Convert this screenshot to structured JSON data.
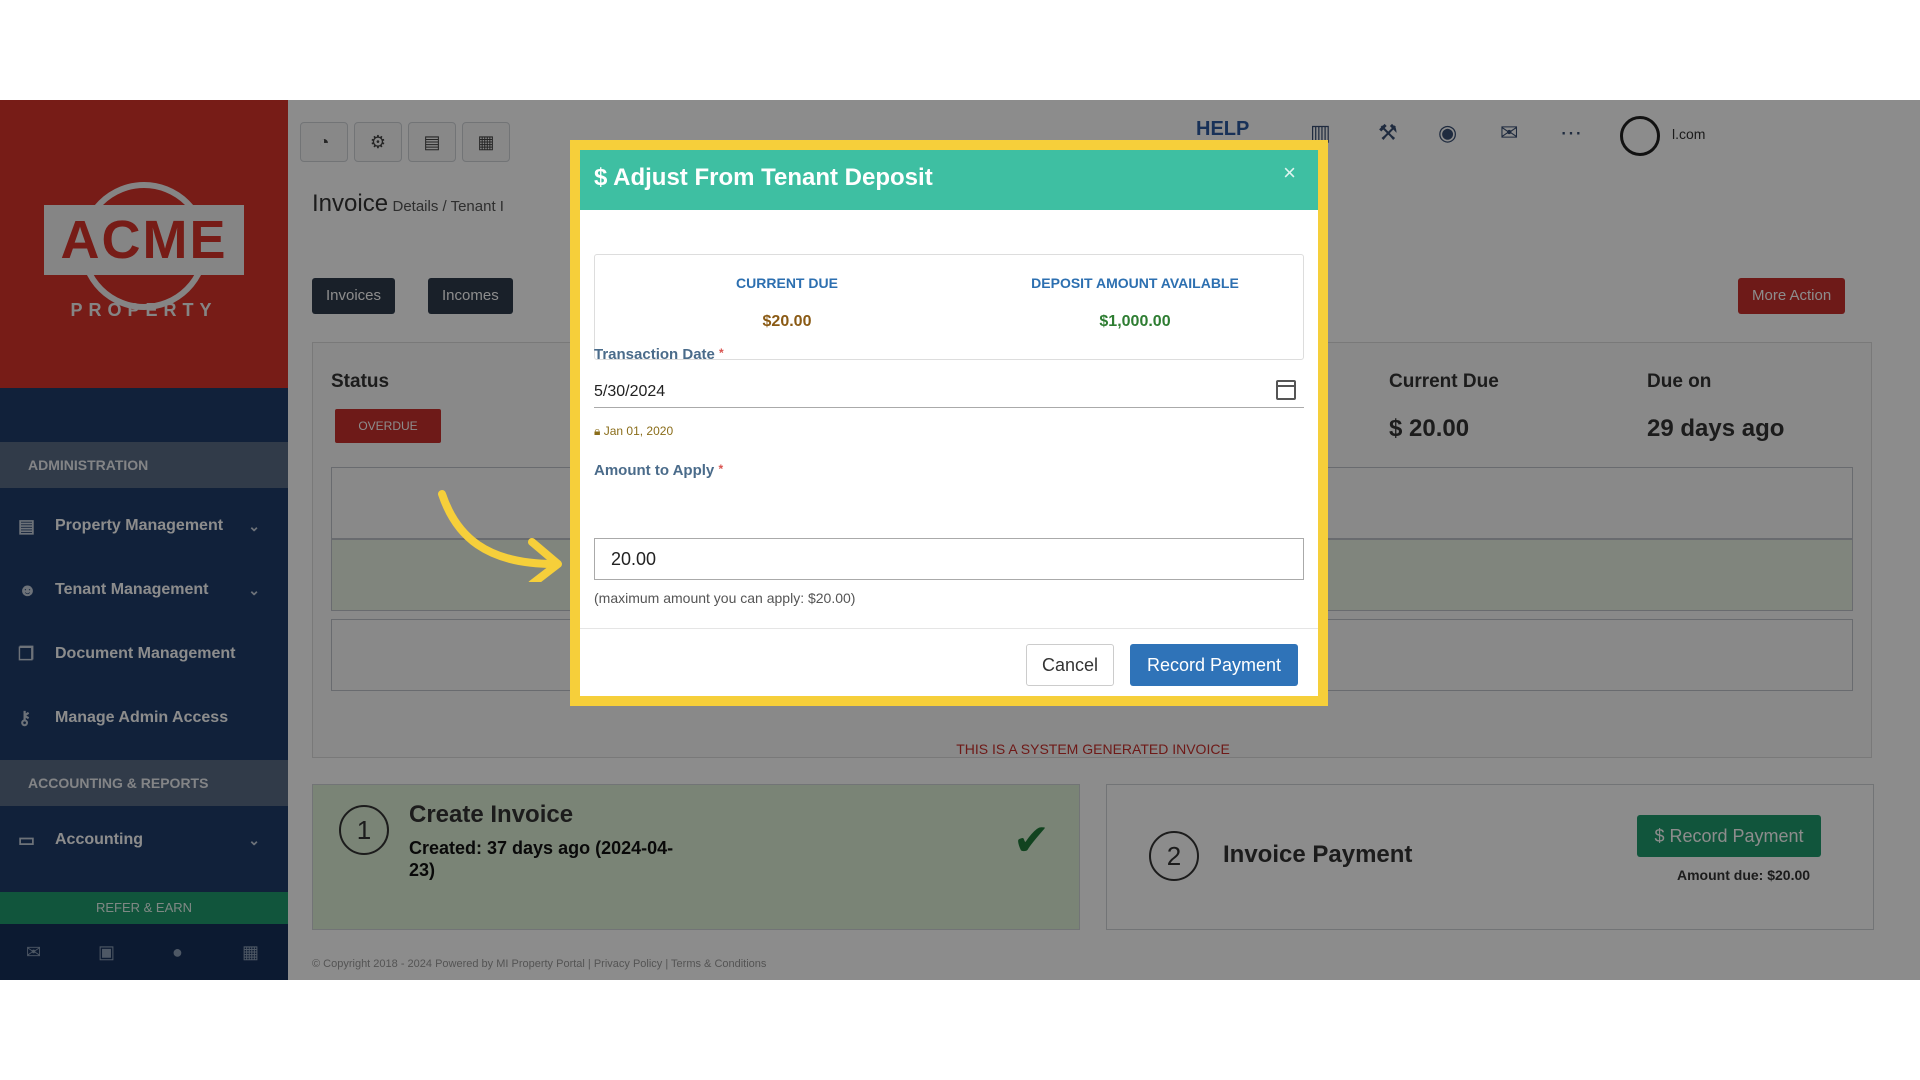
{
  "sidebar": {
    "logo_text": "ACME",
    "logo_sub": "PROPERTY",
    "sections": {
      "admin": "ADMINISTRATION",
      "accounting": "ACCOUNTING & REPORTS"
    },
    "items": [
      {
        "label": "Property Management",
        "icon": "building-icon"
      },
      {
        "label": "Tenant Management",
        "icon": "users-icon"
      },
      {
        "label": "Document Management",
        "icon": "documents-icon"
      },
      {
        "label": "Manage Admin Access",
        "icon": "key-icon"
      },
      {
        "label": "Accounting",
        "icon": "money-icon"
      }
    ],
    "refer_label": "REFER & EARN"
  },
  "topbar": {
    "help_label": "HELP",
    "user_email": "l.com"
  },
  "page": {
    "title": "Invoice",
    "breadcrumb_sub": "Details / Tenant I",
    "invoices_btn": "Invoices",
    "incomes_btn": "Incomes",
    "more_action_btn": "More Action",
    "status_label": "Status",
    "status_badge": "OVERDUE",
    "current_due_label": "Current Due",
    "current_due_value": "$ 20.00",
    "due_on_label": "Due on",
    "due_on_value": "29 days ago",
    "system_note": "THIS IS A SYSTEM GENERATED INVOICE",
    "copyright": "© Copyright 2018 - 2024 Powered by MI Property Portal | Privacy Policy | Terms & Conditions"
  },
  "steps": {
    "create": {
      "number": "1",
      "title": "Create Invoice",
      "subtitle": "Created: 37 days ago (2024-04-23)"
    },
    "payment": {
      "number": "2",
      "title": "Invoice Payment",
      "button": "$ Record Payment",
      "amount_due": "Amount due: $20.00"
    }
  },
  "modal": {
    "title": "$ Adjust From Tenant Deposit",
    "current_due_label": "CURRENT DUE",
    "current_due_value": "$20.00",
    "deposit_label": "DEPOSIT AMOUNT AVAILABLE",
    "deposit_value": "$1,000.00",
    "date_label": "Transaction Date",
    "date_value": "5/30/2024",
    "lock_note": "Jan 01, 2020",
    "amount_label": "Amount to Apply",
    "amount_value": "20.00",
    "amount_help": "(maximum amount you can apply: $20.00)",
    "cancel_label": "Cancel",
    "record_label": "Record Payment",
    "required_mark": "*",
    "close_glyph": "×"
  },
  "colors": {
    "modal_header": "#3ebfa2",
    "modal_border": "#f6cf3a",
    "primary": "#2f73b8",
    "danger": "#c9302c",
    "success": "#1f9b6d"
  }
}
